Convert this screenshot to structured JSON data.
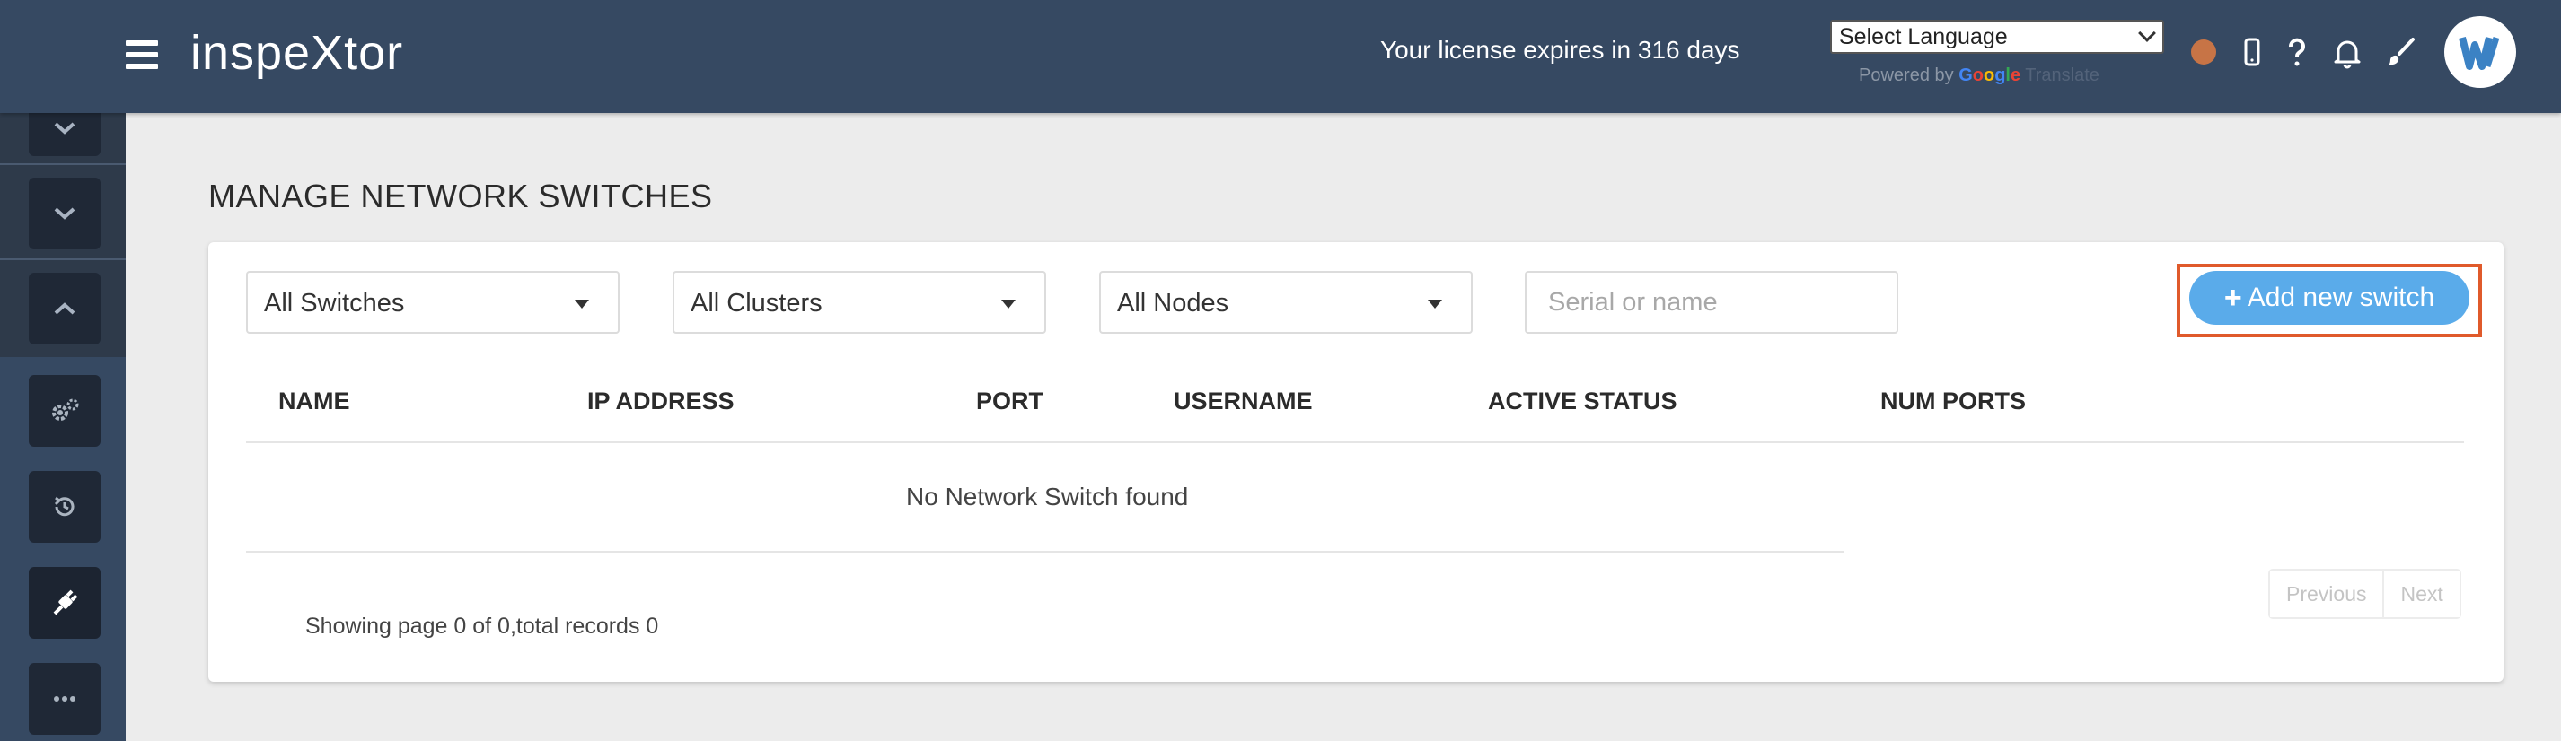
{
  "header": {
    "app_title": "inspeXtor",
    "license_text": "Your license expires in 316 days",
    "language_select": "Select Language",
    "powered_by": "Powered by",
    "google_letters": [
      "G",
      "o",
      "o",
      "g",
      "l",
      "e"
    ],
    "translate": "Translate",
    "status_color": "#c77446",
    "icons": [
      "menu-icon",
      "mobile-icon",
      "help-icon",
      "bell-icon",
      "brush-icon",
      "user-avatar"
    ]
  },
  "sidebar": {
    "items": [
      {
        "icon": "chevron-down-icon"
      },
      {
        "icon": "chevron-down-icon"
      },
      {
        "icon": "chevron-up-icon"
      },
      {
        "icon": "gears-icon"
      },
      {
        "icon": "history-icon"
      },
      {
        "icon": "plug-icon",
        "active": true
      },
      {
        "icon": "more-icon"
      }
    ]
  },
  "page": {
    "title": "MANAGE NETWORK SWITCHES"
  },
  "filters": {
    "switches": "All Switches",
    "clusters": "All Clusters",
    "nodes": "All Nodes",
    "search_placeholder": "Serial or name",
    "add_button": "Add new switch"
  },
  "table": {
    "columns": [
      "NAME",
      "IP ADDRESS",
      "PORT",
      "USERNAME",
      "ACTIVE STATUS",
      "NUM PORTS"
    ],
    "empty_message": "No Network Switch found"
  },
  "pagination": {
    "previous": "Previous",
    "next": "Next",
    "summary": "Showing page 0 of 0,total records 0"
  },
  "colors": {
    "header_bg": "#364962",
    "accent": "#5aabea",
    "highlight": "#e05a2b"
  }
}
